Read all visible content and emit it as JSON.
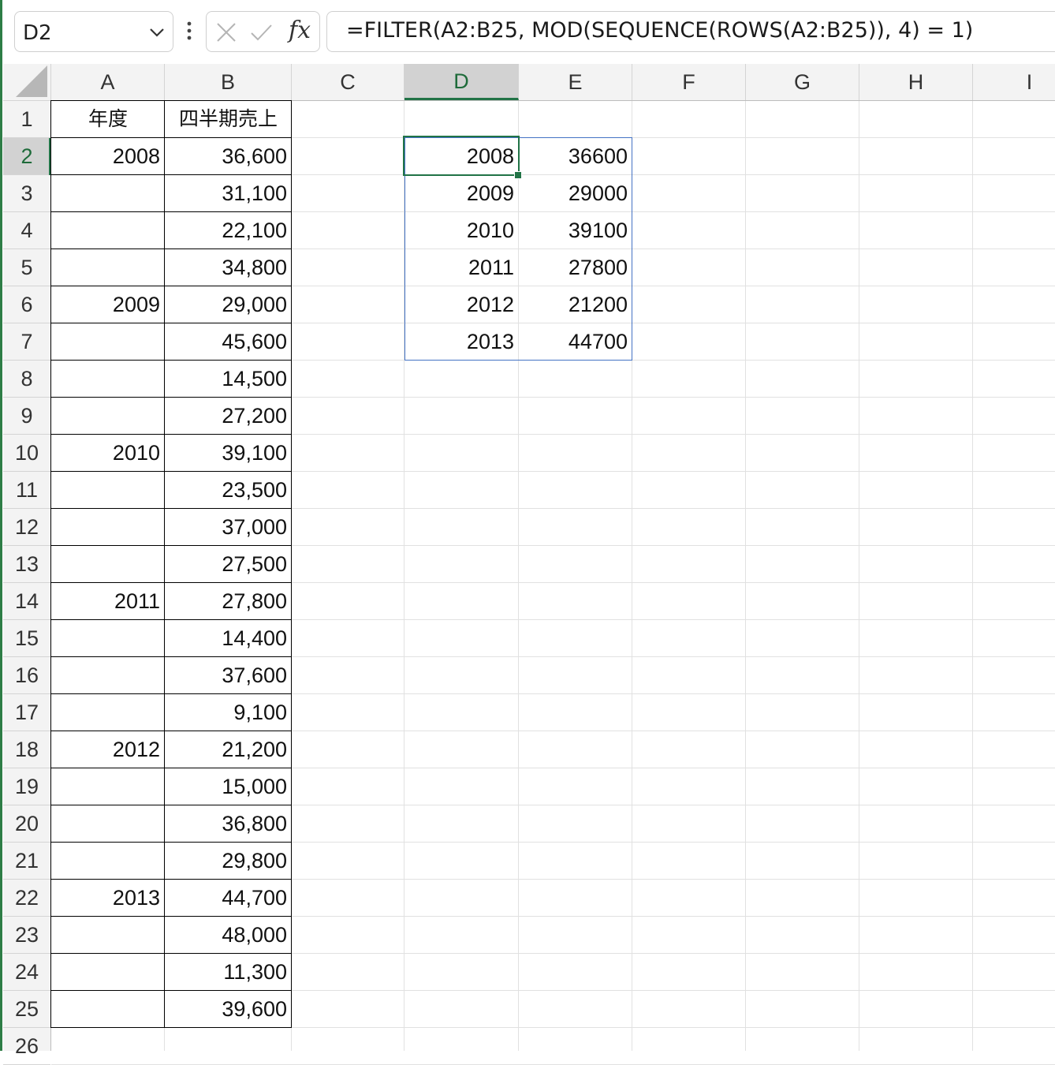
{
  "formula_bar": {
    "name_box": "D2",
    "formula": "=FILTER(A2:B25, MOD(SEQUENCE(ROWS(A2:B25)), 4) = 1)",
    "fx_label": "fx"
  },
  "columns": [
    "A",
    "B",
    "C",
    "D",
    "E",
    "F",
    "G",
    "H",
    "I"
  ],
  "rows": [
    "1",
    "2",
    "3",
    "4",
    "5",
    "6",
    "7",
    "8",
    "9",
    "10",
    "11",
    "12",
    "13",
    "14",
    "15",
    "16",
    "17",
    "18",
    "19",
    "20",
    "21",
    "22",
    "23",
    "24",
    "25",
    "26"
  ],
  "header": {
    "a1": "年度",
    "b1": "四半期売上"
  },
  "table": [
    {
      "year": "2008",
      "sales": "36,600"
    },
    {
      "year": "",
      "sales": "31,100"
    },
    {
      "year": "",
      "sales": "22,100"
    },
    {
      "year": "",
      "sales": "34,800"
    },
    {
      "year": "2009",
      "sales": "29,000"
    },
    {
      "year": "",
      "sales": "45,600"
    },
    {
      "year": "",
      "sales": "14,500"
    },
    {
      "year": "",
      "sales": "27,200"
    },
    {
      "year": "2010",
      "sales": "39,100"
    },
    {
      "year": "",
      "sales": "23,500"
    },
    {
      "year": "",
      "sales": "37,000"
    },
    {
      "year": "",
      "sales": "27,500"
    },
    {
      "year": "2011",
      "sales": "27,800"
    },
    {
      "year": "",
      "sales": "14,400"
    },
    {
      "year": "",
      "sales": "37,600"
    },
    {
      "year": "",
      "sales": "9,100"
    },
    {
      "year": "2012",
      "sales": "21,200"
    },
    {
      "year": "",
      "sales": "15,000"
    },
    {
      "year": "",
      "sales": "36,800"
    },
    {
      "year": "",
      "sales": "29,800"
    },
    {
      "year": "2013",
      "sales": "44,700"
    },
    {
      "year": "",
      "sales": "48,000"
    },
    {
      "year": "",
      "sales": "11,300"
    },
    {
      "year": "",
      "sales": "39,600"
    }
  ],
  "result": [
    {
      "year": "2008",
      "sales": "36600"
    },
    {
      "year": "2009",
      "sales": "29000"
    },
    {
      "year": "2010",
      "sales": "39100"
    },
    {
      "year": "2011",
      "sales": "27800"
    },
    {
      "year": "2012",
      "sales": "21200"
    },
    {
      "year": "2013",
      "sales": "44700"
    }
  ],
  "colors": {
    "accent_green": "#217346",
    "spill_blue": "#4472c4",
    "header_bg": "#f3f3f3"
  }
}
